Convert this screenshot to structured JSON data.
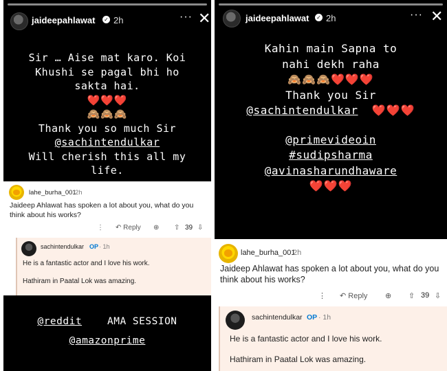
{
  "left": {
    "header": {
      "username": "jaideepahlawat",
      "time": "2h",
      "more": "···",
      "close": "✕"
    },
    "story_lines": [
      "Sir … Aise mat karo. Koi",
      "Khushi se pagal bhi ho",
      "sakta hai.",
      "❤️❤️❤️",
      "🙈🙈🙈",
      "Thank you so much Sir",
      "@sachintendulkar",
      "Will cherish this all my",
      "life."
    ],
    "comment": {
      "username": "lahe_burha_001",
      "time": "2h",
      "text": "Jaideep Ahlawat has spoken a lot about you, what do you think about his works?",
      "actions": {
        "more": "⋮",
        "reply": "Reply",
        "award": "⊕",
        "votes": "39"
      }
    },
    "reply": {
      "username": "sachintendulkar",
      "op": "OP",
      "time": "· 1h",
      "line1": "He is a fantastic actor and I love his work.",
      "line2": "Hathiram in Paatal Lok was amazing."
    },
    "bottom": {
      "reddit": "@reddit",
      "ama": "AMA SESSION",
      "amazon": "@amazonprime"
    }
  },
  "right": {
    "header": {
      "username": "jaideepahlawat",
      "time": "2h",
      "more": "···",
      "close": "✕"
    },
    "story_lines": [
      "Kahin main Sapna to",
      "nahi dekh raha",
      "🙈🙈🙈❤️❤️❤️",
      "Thank you Sir",
      "@sachintendulkar",
      "❤️❤️❤️",
      "@primevideoin",
      "#sudipsharma",
      "@avinasharundhaware",
      "❤️❤️❤️"
    ],
    "comment": {
      "username": "lahe_burha_001",
      "time": "2h",
      "text": "Jaideep Ahlawat has spoken a lot about you, what do you think about his works?",
      "actions": {
        "more": "⋮",
        "reply": "Reply",
        "award": "⊕",
        "votes": "39"
      }
    },
    "reply": {
      "username": "sachintendulkar",
      "op": "OP",
      "time": "· 1h",
      "line1": "He is a fantastic actor and I love his work.",
      "line2": "Hathiram in Paatal Lok was amazing."
    }
  }
}
